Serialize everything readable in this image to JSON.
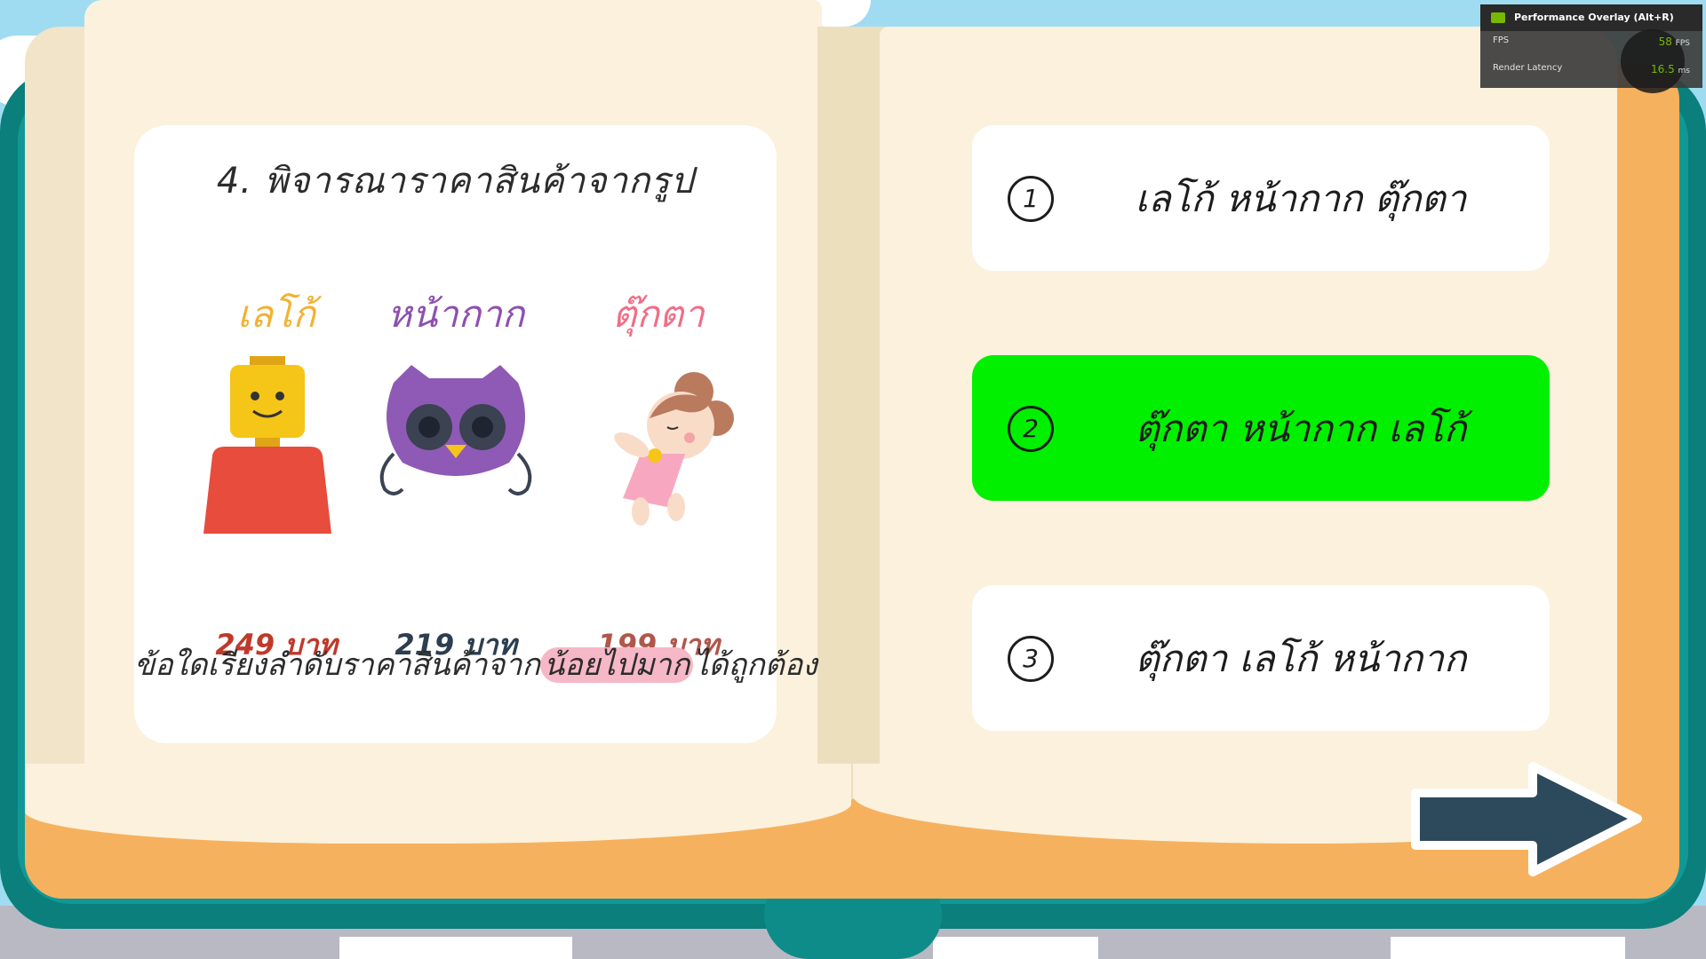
{
  "question": {
    "title": "4. พิจารณาราคาสินค้าจากรูป",
    "items": [
      {
        "name": "เลโก้",
        "price": "249 บาท",
        "icon": "lego-figure-icon",
        "name_color": "#f2b233",
        "price_color": "#c0392b"
      },
      {
        "name": "หน้ากาก",
        "price": "219 บาท",
        "icon": "owl-mask-icon",
        "name_color": "#8e4fb0",
        "price_color": "#2c3e50"
      },
      {
        "name": "ตุ๊กตา",
        "price": "199 บาท",
        "icon": "doll-icon",
        "name_color": "#ef6e86",
        "price_color": "#b0574c"
      }
    ],
    "prompt_before": "ข้อใดเรียงลำดับราคาสินค้าจาก",
    "prompt_highlight": "น้อยไปมาก",
    "prompt_after": "ได้ถูกต้อง"
  },
  "answers": [
    {
      "number": "1",
      "text": "เลโก้ หน้ากาก ตุ๊กตา",
      "selected": false
    },
    {
      "number": "2",
      "text": "ตุ๊กตา หน้ากาก เลโก้",
      "selected": true
    },
    {
      "number": "3",
      "text": "ตุ๊กตา เลโก้ หน้ากาก",
      "selected": false
    }
  ],
  "next_button": {
    "icon": "right-arrow-icon"
  },
  "overlay": {
    "title": "Performance Overlay (Alt+R)",
    "fps_label": "FPS",
    "fps_value": "58",
    "fps_unit": "FPS",
    "latency_label": "Render Latency",
    "latency_value": "16.5",
    "latency_unit": "ms"
  },
  "colors": {
    "selected": "#00f000",
    "book_cover": "#119896",
    "page_edge": "#f6b15e"
  }
}
